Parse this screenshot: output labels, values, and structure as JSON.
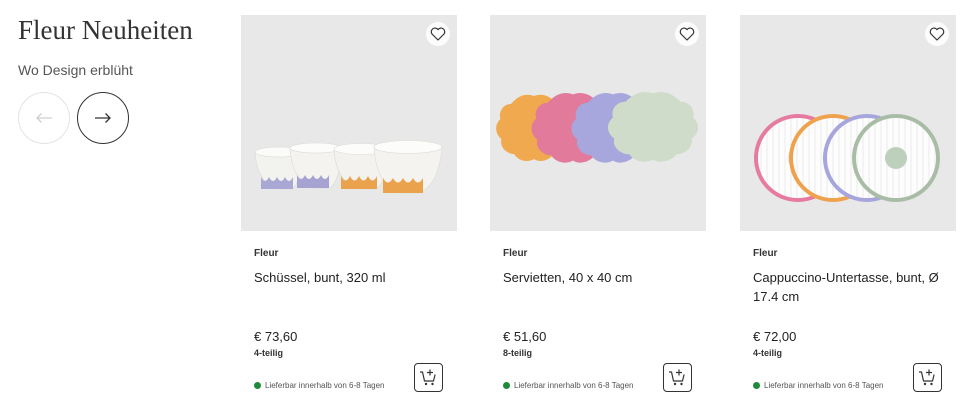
{
  "section": {
    "title": "Fleur Neuheiten",
    "subtitle": "Wo Design erblüht"
  },
  "carousel": {
    "prev_icon": "arrow-left-icon",
    "next_icon": "arrow-right-icon"
  },
  "colors": {
    "availability": "#1e8a3a",
    "image_bg": "#e8e8e8",
    "text": "#222222"
  },
  "products": [
    {
      "brand": "Fleur",
      "name": "Schüssel, bunt, 320 ml",
      "price": "€ 73,60",
      "pieces": "4-teilig",
      "availability": "Lieferbar innerhalb von 6-8 Tagen"
    },
    {
      "brand": "Fleur",
      "name": "Servietten, 40 x 40 cm",
      "price": "€ 51,60",
      "pieces": "8-teilig",
      "availability": "Lieferbar innerhalb von 6-8 Tagen"
    },
    {
      "brand": "Fleur",
      "name": "Cappuccino-Untertasse, bunt, Ø 17.4 cm",
      "price": "€ 72,00",
      "pieces": "4-teilig",
      "availability": "Lieferbar innerhalb von 6-8 Tagen"
    }
  ]
}
